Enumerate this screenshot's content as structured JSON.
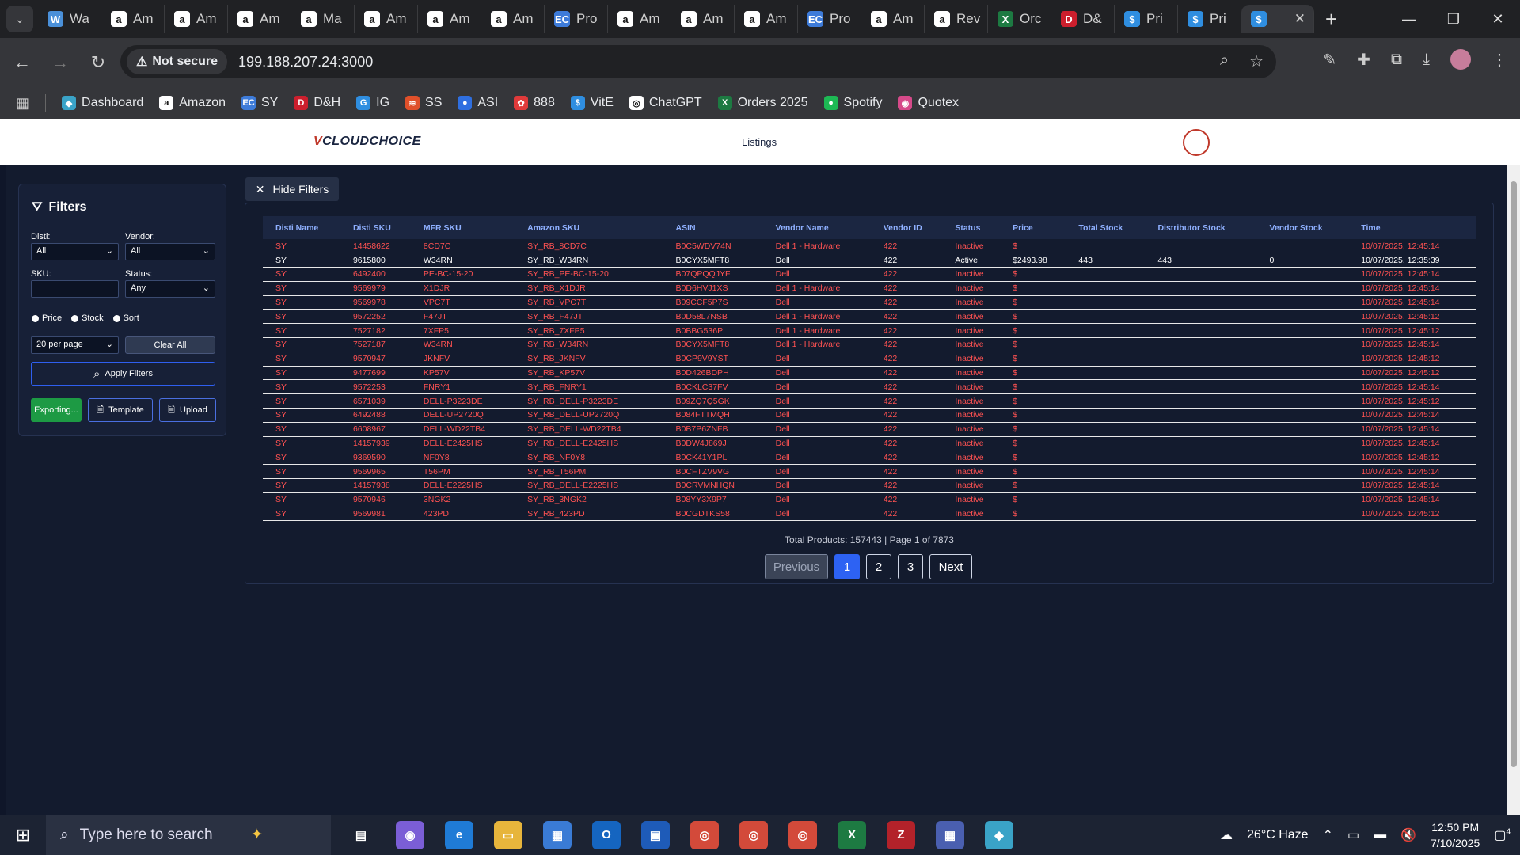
{
  "browser": {
    "tabs": [
      {
        "label": "Wa",
        "icon": "W",
        "color": "#4a90d9"
      },
      {
        "label": "Am",
        "icon": "a",
        "color": "#ffffff"
      },
      {
        "label": "Am",
        "icon": "a",
        "color": "#ffffff"
      },
      {
        "label": "Am",
        "icon": "a",
        "color": "#ffffff"
      },
      {
        "label": "Ma",
        "icon": "a",
        "color": "#ffffff"
      },
      {
        "label": "Am",
        "icon": "a",
        "color": "#ffffff"
      },
      {
        "label": "Am",
        "icon": "a",
        "color": "#ffffff"
      },
      {
        "label": "Am",
        "icon": "a",
        "color": "#ffffff"
      },
      {
        "label": "Pro",
        "icon": "EC",
        "color": "#3d7bd9"
      },
      {
        "label": "Am",
        "icon": "a",
        "color": "#ffffff"
      },
      {
        "label": "Am",
        "icon": "a",
        "color": "#ffffff"
      },
      {
        "label": "Am",
        "icon": "a",
        "color": "#ffffff"
      },
      {
        "label": "Pro",
        "icon": "EC",
        "color": "#3d7bd9"
      },
      {
        "label": "Am",
        "icon": "a",
        "color": "#ffffff"
      },
      {
        "label": "Rev",
        "icon": "a",
        "color": "#ffffff"
      },
      {
        "label": "Orc",
        "icon": "X",
        "color": "#1d7a42"
      },
      {
        "label": "D&",
        "icon": "D",
        "color": "#cc1f2d"
      },
      {
        "label": "Pri",
        "icon": "$",
        "color": "#2f8ee0"
      },
      {
        "label": "Pri",
        "icon": "$",
        "color": "#2f8ee0"
      },
      {
        "label": "",
        "icon": "$",
        "color": "#2f8ee0",
        "active": true
      }
    ],
    "not_secure": "Not secure",
    "url": "199.188.207.24:3000",
    "bookmarks": [
      {
        "label": "Dashboard",
        "icon": "◆",
        "color": "#3aa3c7"
      },
      {
        "label": "Amazon",
        "icon": "a",
        "color": "#ffffff"
      },
      {
        "label": "SY",
        "icon": "EC",
        "color": "#3d7bd9"
      },
      {
        "label": "D&H",
        "icon": "D",
        "color": "#cc1f2d"
      },
      {
        "label": "IG",
        "icon": "G",
        "color": "#2f8ee0"
      },
      {
        "label": "SS",
        "icon": "≋",
        "color": "#e0502a"
      },
      {
        "label": "ASI",
        "icon": "●",
        "color": "#2f6fe0"
      },
      {
        "label": "888",
        "icon": "✿",
        "color": "#e03a3a"
      },
      {
        "label": "VitE",
        "icon": "$",
        "color": "#2f8ee0"
      },
      {
        "label": "ChatGPT",
        "icon": "◎",
        "color": "#ffffff"
      },
      {
        "label": "Orders 2025",
        "icon": "X",
        "color": "#1d7a42"
      },
      {
        "label": "Spotify",
        "icon": "●",
        "color": "#1db954"
      },
      {
        "label": "Quotex",
        "icon": "◉",
        "color": "#d64a8a"
      }
    ]
  },
  "app": {
    "logo_v": "V",
    "logo_text": "CLOUDCHOICE",
    "nav_listings": "Listings"
  },
  "filters": {
    "title": "Filters",
    "disti_label": "Disti:",
    "disti_value": "All",
    "vendor_label": "Vendor:",
    "vendor_value": "All",
    "sku_label": "SKU:",
    "sku_value": "",
    "status_label": "Status:",
    "status_value": "Any",
    "radio_price": "Price",
    "radio_stock": "Stock",
    "radio_sort": "Sort",
    "per_page": "20 per page",
    "clear_all": "Clear All",
    "apply": "Apply Filters",
    "exporting": "Exporting...",
    "template": "Template",
    "upload": "Upload"
  },
  "hide_filters": "Hide Filters",
  "table": {
    "headers": [
      "Disti Name",
      "Disti SKU",
      "MFR SKU",
      "Amazon SKU",
      "ASIN",
      "Vendor Name",
      "Vendor ID",
      "Status",
      "Price",
      "Total Stock",
      "Distributor Stock",
      "Vendor Stock",
      "Time"
    ],
    "rows": [
      [
        "SY",
        "14458622",
        "8CD7C",
        "SY_RB_8CD7C",
        "B0C5WDV74N",
        "Dell 1 - Hardware",
        "422",
        "Inactive",
        "$",
        "",
        "",
        "",
        "10/07/2025, 12:45:14"
      ],
      [
        "SY",
        "9615800",
        "W34RN",
        "SY_RB_W34RN",
        "B0CYX5MFT8",
        "Dell",
        "422",
        "Active",
        "$2493.98",
        "443",
        "443",
        "0",
        "10/07/2025, 12:35:39"
      ],
      [
        "SY",
        "6492400",
        "PE-BC-15-20",
        "SY_RB_PE-BC-15-20",
        "B07QPQQJYF",
        "Dell",
        "422",
        "Inactive",
        "$",
        "",
        "",
        "",
        "10/07/2025, 12:45:14"
      ],
      [
        "SY",
        "9569979",
        "X1DJR",
        "SY_RB_X1DJR",
        "B0D6HVJ1XS",
        "Dell 1 - Hardware",
        "422",
        "Inactive",
        "$",
        "",
        "",
        "",
        "10/07/2025, 12:45:14"
      ],
      [
        "SY",
        "9569978",
        "VPC7T",
        "SY_RB_VPC7T",
        "B09CCF5P7S",
        "Dell",
        "422",
        "Inactive",
        "$",
        "",
        "",
        "",
        "10/07/2025, 12:45:14"
      ],
      [
        "SY",
        "9572252",
        "F47JT",
        "SY_RB_F47JT",
        "B0D58L7NSB",
        "Dell 1 - Hardware",
        "422",
        "Inactive",
        "$",
        "",
        "",
        "",
        "10/07/2025, 12:45:12"
      ],
      [
        "SY",
        "7527182",
        "7XFP5",
        "SY_RB_7XFP5",
        "B0BBG536PL",
        "Dell 1 - Hardware",
        "422",
        "Inactive",
        "$",
        "",
        "",
        "",
        "10/07/2025, 12:45:12"
      ],
      [
        "SY",
        "7527187",
        "W34RN",
        "SY_RB_W34RN",
        "B0CYX5MFT8",
        "Dell 1 - Hardware",
        "422",
        "Inactive",
        "$",
        "",
        "",
        "",
        "10/07/2025, 12:45:14"
      ],
      [
        "SY",
        "9570947",
        "JKNFV",
        "SY_RB_JKNFV",
        "B0CP9V9YST",
        "Dell",
        "422",
        "Inactive",
        "$",
        "",
        "",
        "",
        "10/07/2025, 12:45:12"
      ],
      [
        "SY",
        "9477699",
        "KP57V",
        "SY_RB_KP57V",
        "B0D426BDPH",
        "Dell",
        "422",
        "Inactive",
        "$",
        "",
        "",
        "",
        "10/07/2025, 12:45:12"
      ],
      [
        "SY",
        "9572253",
        "FNRY1",
        "SY_RB_FNRY1",
        "B0CKLC37FV",
        "Dell",
        "422",
        "Inactive",
        "$",
        "",
        "",
        "",
        "10/07/2025, 12:45:14"
      ],
      [
        "SY",
        "6571039",
        "DELL-P3223DE",
        "SY_RB_DELL-P3223DE",
        "B09ZQ7Q5GK",
        "Dell",
        "422",
        "Inactive",
        "$",
        "",
        "",
        "",
        "10/07/2025, 12:45:12"
      ],
      [
        "SY",
        "6492488",
        "DELL-UP2720Q",
        "SY_RB_DELL-UP2720Q",
        "B084FTTMQH",
        "Dell",
        "422",
        "Inactive",
        "$",
        "",
        "",
        "",
        "10/07/2025, 12:45:14"
      ],
      [
        "SY",
        "6608967",
        "DELL-WD22TB4",
        "SY_RB_DELL-WD22TB4",
        "B0B7P6ZNFB",
        "Dell",
        "422",
        "Inactive",
        "$",
        "",
        "",
        "",
        "10/07/2025, 12:45:14"
      ],
      [
        "SY",
        "14157939",
        "DELL-E2425HS",
        "SY_RB_DELL-E2425HS",
        "B0DW4J869J",
        "Dell",
        "422",
        "Inactive",
        "$",
        "",
        "",
        "",
        "10/07/2025, 12:45:14"
      ],
      [
        "SY",
        "9369590",
        "NF0Y8",
        "SY_RB_NF0Y8",
        "B0CK41Y1PL",
        "Dell",
        "422",
        "Inactive",
        "$",
        "",
        "",
        "",
        "10/07/2025, 12:45:12"
      ],
      [
        "SY",
        "9569965",
        "T56PM",
        "SY_RB_T56PM",
        "B0CFTZV9VG",
        "Dell",
        "422",
        "Inactive",
        "$",
        "",
        "",
        "",
        "10/07/2025, 12:45:14"
      ],
      [
        "SY",
        "14157938",
        "DELL-E2225HS",
        "SY_RB_DELL-E2225HS",
        "B0CRVMNHQN",
        "Dell",
        "422",
        "Inactive",
        "$",
        "",
        "",
        "",
        "10/07/2025, 12:45:14"
      ],
      [
        "SY",
        "9570946",
        "3NGK2",
        "SY_RB_3NGK2",
        "B08YY3X9P7",
        "Dell",
        "422",
        "Inactive",
        "$",
        "",
        "",
        "",
        "10/07/2025, 12:45:14"
      ],
      [
        "SY",
        "9569981",
        "423PD",
        "SY_RB_423PD",
        "B0CGDTKS58",
        "Dell",
        "422",
        "Inactive",
        "$",
        "",
        "",
        "",
        "10/07/2025, 12:45:12"
      ]
    ]
  },
  "pagination": {
    "info": "Total Products: 157443 | Page 1 of 7873",
    "previous": "Previous",
    "pages": [
      "1",
      "2",
      "3"
    ],
    "next": "Next"
  },
  "taskbar": {
    "search_placeholder": "Type here to search",
    "weather": "26°C  Haze",
    "time": "12:50 PM",
    "date": "7/10/2025",
    "notif_count": "4"
  }
}
